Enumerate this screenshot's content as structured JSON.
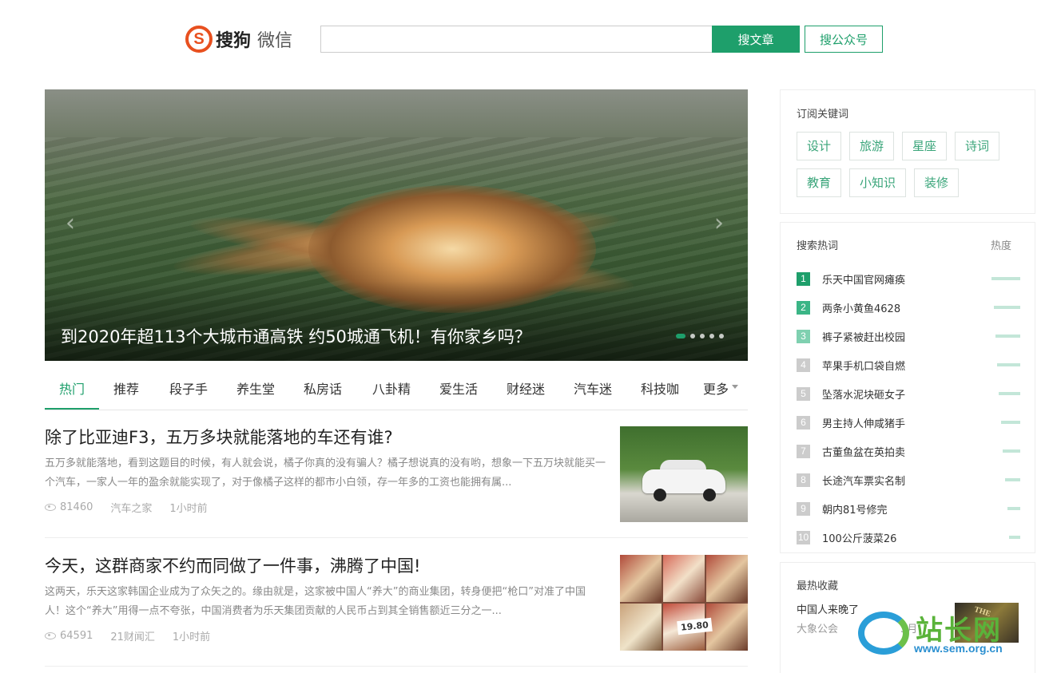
{
  "header": {
    "logo_glyph": "S",
    "brand": "搜狗",
    "product": "微信",
    "search_placeholder": "",
    "search_article_button": "搜文章",
    "search_account_button": "搜公众号",
    "accent_color": "#1e9f6b"
  },
  "banner": {
    "caption": "到2020年超113个大城市通高铁 约50城通飞机！有你家乡吗？",
    "prev_arrow": "‹",
    "next_arrow": "›",
    "slide_count": 5,
    "active_slide": 1
  },
  "tabs": [
    {
      "label": "热门",
      "active": true
    },
    {
      "label": "推荐"
    },
    {
      "label": "段子手"
    },
    {
      "label": "养生堂"
    },
    {
      "label": "私房话"
    },
    {
      "label": "八卦精"
    },
    {
      "label": "爱生活"
    },
    {
      "label": "财经迷"
    },
    {
      "label": "汽车迷"
    },
    {
      "label": "科技咖"
    },
    {
      "label": "更多"
    }
  ],
  "articles": [
    {
      "title": "除了比亚迪F3，五万多块就能落地的车还有谁?",
      "summary": "五万多就能落地，看到这题目的时候，有人就会说，橘子你真的没有骗人？橘子想说真的没有哟，想象一下五万块就能买一个汽车，一家人一年的盈余就能实现了，对于像橘子这样的都市小白领，存一年多的工资也能拥有属...",
      "views": "81460",
      "source": "汽车之家",
      "time": "1小时前"
    },
    {
      "title": "今天，这群商家不约而同做了一件事，沸腾了中国!",
      "summary": "这两天，乐天这家韩国企业成为了众矢之的。缘由就是，这家被中国人“养大”的商业集团，转身便把“枪口”对准了中国人！这个“养大”用得一点不夸张，中国消费者为乐天集团贡献的人民币占到其全销售额近三分之一...",
      "views": "64591",
      "source": "21财闻汇",
      "time": "1小时前",
      "thumb_price": "19.80"
    }
  ],
  "keywords": {
    "title": "订阅关键词",
    "items": [
      "设计",
      "旅游",
      "星座",
      "诗词",
      "教育",
      "小知识",
      "装修"
    ]
  },
  "hot": {
    "title": "搜索热词",
    "heat_label": "热度",
    "items": [
      {
        "rank": "1",
        "word": "乐天中国官网瘫痪",
        "heat": 1.0
      },
      {
        "rank": "2",
        "word": "两条小黄鱼4628",
        "heat": 0.92
      },
      {
        "rank": "3",
        "word": "裤子紧被赶出校园",
        "heat": 0.86
      },
      {
        "rank": "4",
        "word": "苹果手机口袋自燃",
        "heat": 0.8
      },
      {
        "rank": "5",
        "word": "坠落水泥块砸女子",
        "heat": 0.74
      },
      {
        "rank": "6",
        "word": "男主持人伸咸猪手",
        "heat": 0.68
      },
      {
        "rank": "7",
        "word": "古董鱼盆在英拍卖",
        "heat": 0.6
      },
      {
        "rank": "8",
        "word": "长途汽车票实名制",
        "heat": 0.52
      },
      {
        "rank": "9",
        "word": "朝内81号修完",
        "heat": 0.44
      },
      {
        "rank": "10",
        "word": "100公斤菠菜26",
        "heat": 0.38
      }
    ]
  },
  "favorites": {
    "title": "最热收藏",
    "item_title": "中国人来晚了",
    "item_source": "大象公会",
    "item_date": "3月"
  },
  "watermark": {
    "text": "站长网",
    "url": "www.sem.org.cn"
  }
}
